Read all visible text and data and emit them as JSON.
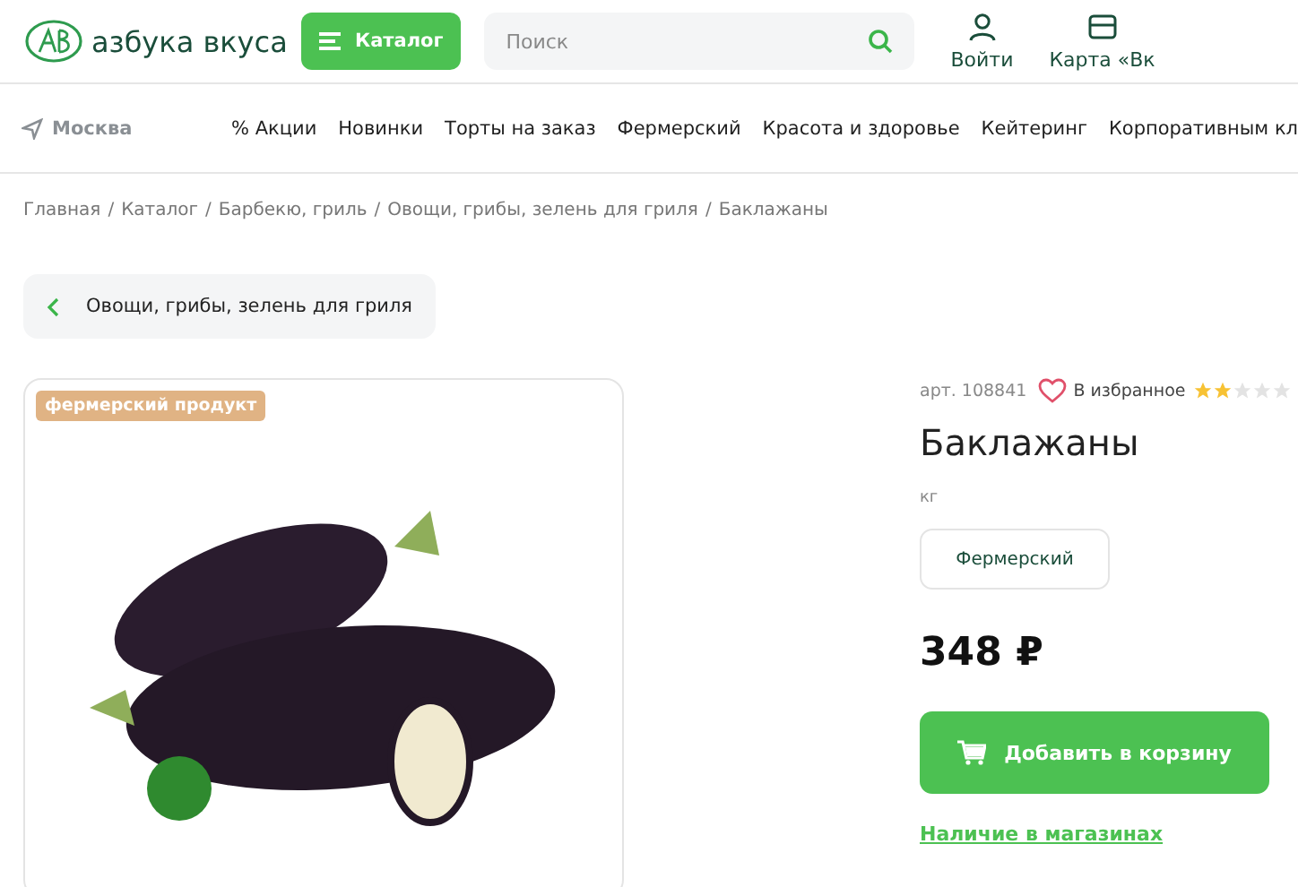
{
  "header": {
    "logo_text": "азбука вкуса",
    "catalog_button": "Каталог",
    "search": {
      "placeholder": "Поиск"
    },
    "actions": [
      {
        "kind": "user",
        "label": "Войти"
      },
      {
        "kind": "card",
        "label": "Карта «Вк"
      }
    ]
  },
  "nav": {
    "city": "Москва",
    "items": [
      "% Акции",
      "Новинки",
      "Торты на заказ",
      "Фермерский",
      "Красота и здоровье",
      "Кейтеринг",
      "Корпоративным кл"
    ]
  },
  "breadcrumb_separator": "/",
  "breadcrumbs": [
    "Главная",
    "Каталог",
    "Барбекю, гриль",
    "Овощи, грибы, зелень для гриля",
    "Баклажаны"
  ],
  "back_link": "Овощи, грибы, зелень для гриля",
  "product": {
    "badge": "фермерский продукт",
    "article": "арт. 108841",
    "favorite": {
      "label": "В избранное",
      "selected": false
    },
    "stars": 2,
    "title": "Баклажаны",
    "unit": "кг",
    "tags": [
      "Фермерский"
    ],
    "price": "348 ₽",
    "add_button": "Добавить в корзину",
    "availability_link": "Наличие в магазинах"
  }
}
